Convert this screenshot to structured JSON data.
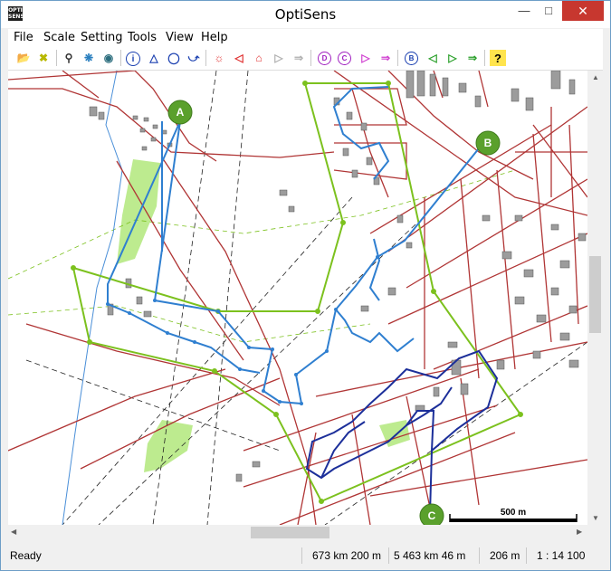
{
  "window": {
    "title": "OptiSens",
    "app_icon_text": "OPTI SENS"
  },
  "menu": [
    "File",
    "Scale",
    "Setting",
    "Tools",
    "View",
    "Help"
  ],
  "toolbar": {
    "icons": [
      "open-folder-icon",
      "close-x-icon",
      "zoom-icon",
      "scatter-icon",
      "globe-icon",
      "info-icon",
      "triangle-icon",
      "circle-icon",
      "route-icon",
      "sun-icon",
      "flag-red-icon",
      "boot-icon",
      "play-grey-icon",
      "forward-grey-icon",
      "d-circle-icon",
      "c-circle-icon",
      "play-pink-icon",
      "forward-pink-icon",
      "b-circle-icon",
      "flag-green-icon",
      "play-green-icon",
      "forward-green-icon",
      "help-icon"
    ],
    "letters": {
      "info": "i",
      "d": "D",
      "c": "C",
      "b": "B",
      "help": "?"
    }
  },
  "map": {
    "markers": [
      {
        "id": "A",
        "color": "#5aa02c"
      },
      {
        "id": "B",
        "color": "#5aa02c"
      },
      {
        "id": "C",
        "color": "#5aa02c"
      }
    ],
    "scale_label": "500 m",
    "colors": {
      "roads": "#b03535",
      "route_light": "#2f7fd0",
      "route_dark": "#1c2f9a",
      "boundary": "#7cc11e",
      "green": "#bdeb8f"
    }
  },
  "status": {
    "state": "Ready",
    "x": "673 km 200 m",
    "y": "5 463 km 46 m",
    "dist": "206 m",
    "scale": "1 : 14 100"
  }
}
